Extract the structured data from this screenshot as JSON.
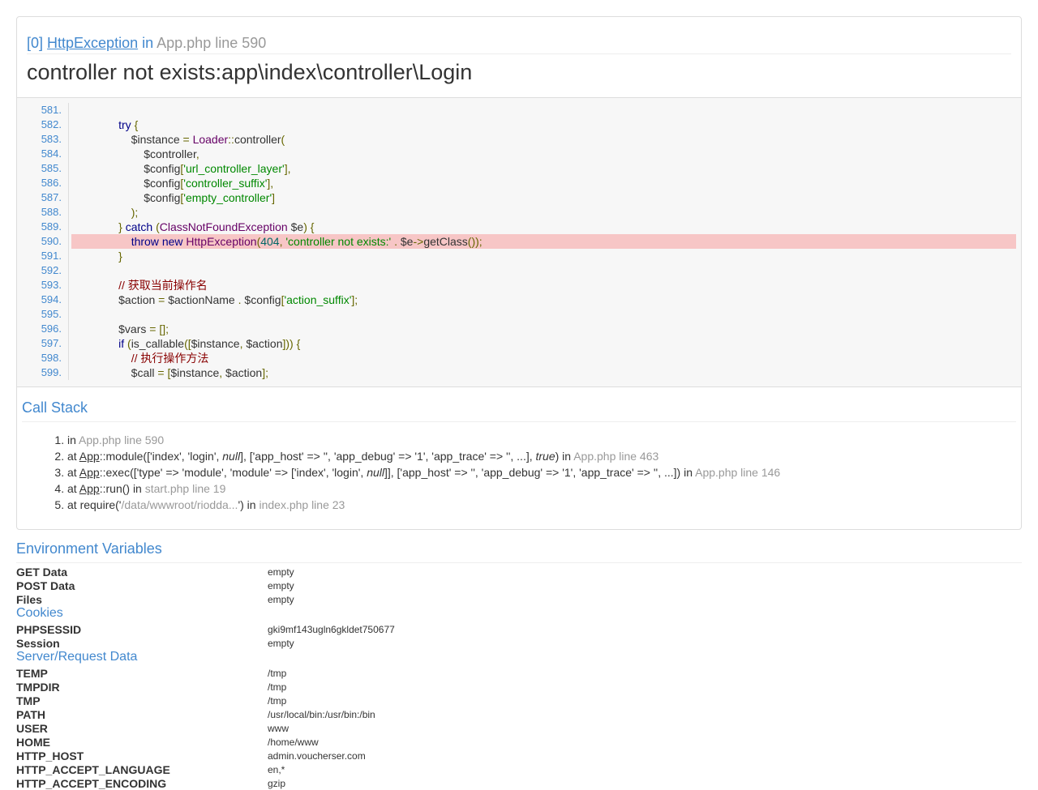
{
  "exception": {
    "index": "[0]",
    "class_name": "HttpException",
    "in_word": "in",
    "file_line": "App.php line 590",
    "message": "controller not exists:app\\index\\controller\\Login"
  },
  "source": {
    "highlight_line": "590.",
    "lines": [
      {
        "num": "581.",
        "html": ""
      },
      {
        "num": "582.",
        "html": "        <span class=\"kw\">try</span> <span class=\"pun\">{</span>"
      },
      {
        "num": "583.",
        "html": "            $instance <span class=\"pun\">=</span> <span class=\"cls\">Loader</span><span class=\"pun\">::</span>controller<span class=\"pun\">(</span>"
      },
      {
        "num": "584.",
        "html": "                $controller<span class=\"pun\">,</span>"
      },
      {
        "num": "585.",
        "html": "                $config<span class=\"pun\">[</span><span class=\"str\">'url_controller_layer'</span><span class=\"pun\">],</span>"
      },
      {
        "num": "586.",
        "html": "                $config<span class=\"pun\">[</span><span class=\"str\">'controller_suffix'</span><span class=\"pun\">],</span>"
      },
      {
        "num": "587.",
        "html": "                $config<span class=\"pun\">[</span><span class=\"str\">'empty_controller'</span><span class=\"pun\">]</span>"
      },
      {
        "num": "588.",
        "html": "            <span class=\"pun\">);</span>"
      },
      {
        "num": "589.",
        "html": "        <span class=\"pun\">}</span> <span class=\"kw\">catch</span> <span class=\"pun\">(</span><span class=\"cls\">ClassNotFoundException</span> $e<span class=\"pun\">)</span> <span class=\"pun\">{</span>"
      },
      {
        "num": "590.",
        "html": "            <span class=\"kw\">throw</span> <span class=\"kw\">new</span> <span class=\"cls\">HttpException</span><span class=\"pun\">(</span><span class=\"lit\">404</span><span class=\"pun\">,</span> <span class=\"str\">'controller not exists:'</span> <span class=\"pun\">.</span> $e<span class=\"pun\">-&gt;</span>getClass<span class=\"pun\">());</span>"
      },
      {
        "num": "591.",
        "html": "        <span class=\"pun\">}</span>"
      },
      {
        "num": "592.",
        "html": ""
      },
      {
        "num": "593.",
        "html": "        <span class=\"com\">// 获取当前操作名</span>"
      },
      {
        "num": "594.",
        "html": "        $action <span class=\"pun\">=</span> $actionName <span class=\"pun\">.</span> $config<span class=\"pun\">[</span><span class=\"str\">'action_suffix'</span><span class=\"pun\">];</span>"
      },
      {
        "num": "595.",
        "html": ""
      },
      {
        "num": "596.",
        "html": "        $vars <span class=\"pun\">=</span> <span class=\"pun\">[];</span>"
      },
      {
        "num": "597.",
        "html": "        <span class=\"kw\">if</span> <span class=\"pun\">(</span>is_callable<span class=\"pun\">([</span>$instance<span class=\"pun\">,</span> $action<span class=\"pun\">]))</span> <span class=\"pun\">{</span>"
      },
      {
        "num": "598.",
        "html": "            <span class=\"com\">// 执行操作方法</span>"
      },
      {
        "num": "599.",
        "html": "            $call <span class=\"pun\">=</span> <span class=\"pun\">[</span>$instance<span class=\"pun\">,</span> $action<span class=\"pun\">];</span>"
      }
    ]
  },
  "call_stack": {
    "title": "Call Stack",
    "items": [
      {
        "html": "in <span class=\"file\">App.php line 590</span>"
      },
      {
        "html": "at <u>App</u>::module(['index', 'login', <i>null</i>], ['app_host' =&gt; '', 'app_debug' =&gt; '1', 'app_trace' =&gt; '', ...], <i>true</i>) in <span class=\"file\">App.php line 463</span>"
      },
      {
        "html": "at <u>App</u>::exec(['type' =&gt; 'module', 'module' =&gt; ['index', 'login', <i>null</i>]], ['app_host' =&gt; '', 'app_debug' =&gt; '1', 'app_trace' =&gt; '', ...]) in <span class=\"file\">App.php line 146</span>"
      },
      {
        "html": "at <u>App</u>::run() in <span class=\"file\">start.php line 19</span>"
      },
      {
        "html": "at require('<span class=\"file\">/data/wwwroot/riodda...</span>') in <span class=\"file\">index.php line 23</span>"
      }
    ]
  },
  "environment": {
    "title": "Environment Variables",
    "rows": [
      {
        "type": "kv",
        "key": "GET Data",
        "value": "empty"
      },
      {
        "type": "kv",
        "key": "POST Data",
        "value": "empty"
      },
      {
        "type": "kv",
        "key": "Files",
        "value": "empty"
      },
      {
        "type": "section",
        "label": "Cookies"
      },
      {
        "type": "kv",
        "key": "PHPSESSID",
        "value": "gki9mf143ugln6gkldet750677"
      },
      {
        "type": "kv",
        "key": "Session",
        "value": "empty"
      },
      {
        "type": "section",
        "label": "Server/Request Data"
      },
      {
        "type": "kv",
        "key": "TEMP",
        "value": "/tmp"
      },
      {
        "type": "kv",
        "key": "TMPDIR",
        "value": "/tmp"
      },
      {
        "type": "kv",
        "key": "TMP",
        "value": "/tmp"
      },
      {
        "type": "kv",
        "key": "PATH",
        "value": "/usr/local/bin:/usr/bin:/bin"
      },
      {
        "type": "kv",
        "key": "USER",
        "value": "www"
      },
      {
        "type": "kv",
        "key": "HOME",
        "value": "/home/www"
      },
      {
        "type": "kv",
        "key": "HTTP_HOST",
        "value": "admin.voucherser.com"
      },
      {
        "type": "kv",
        "key": "HTTP_ACCEPT_LANGUAGE",
        "value": "en,*"
      },
      {
        "type": "kv",
        "key": "HTTP_ACCEPT_ENCODING",
        "value": "gzip"
      }
    ]
  }
}
